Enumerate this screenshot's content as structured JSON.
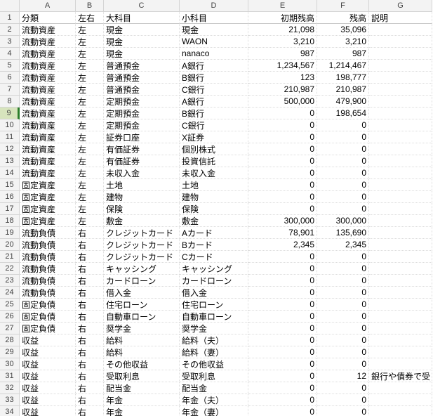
{
  "columns": [
    "A",
    "B",
    "C",
    "D",
    "E",
    "F",
    "G"
  ],
  "headers": {
    "A": "分類",
    "B": "左右",
    "C": "大科目",
    "D": "小科目",
    "E": "初期残高",
    "F": "残高",
    "G": "説明"
  },
  "selected_row": 9,
  "chart_data": {
    "type": "table",
    "columns": [
      "分類",
      "左右",
      "大科目",
      "小科目",
      "初期残高",
      "残高",
      "説明"
    ],
    "rows": [
      [
        "流動資産",
        "左",
        "現金",
        "現金",
        "21,098",
        "35,096",
        ""
      ],
      [
        "流動資産",
        "左",
        "現金",
        "WAON",
        "3,210",
        "3,210",
        ""
      ],
      [
        "流動資産",
        "左",
        "現金",
        "nanaco",
        "987",
        "987",
        ""
      ],
      [
        "流動資産",
        "左",
        "普通預金",
        "A銀行",
        "1,234,567",
        "1,214,467",
        ""
      ],
      [
        "流動資産",
        "左",
        "普通預金",
        "B銀行",
        "123",
        "198,777",
        ""
      ],
      [
        "流動資産",
        "左",
        "普通預金",
        "C銀行",
        "210,987",
        "210,987",
        ""
      ],
      [
        "流動資産",
        "左",
        "定期預金",
        "A銀行",
        "500,000",
        "479,900",
        ""
      ],
      [
        "流動資産",
        "左",
        "定期預金",
        "B銀行",
        "0",
        "198,654",
        ""
      ],
      [
        "流動資産",
        "左",
        "定期預金",
        "C銀行",
        "0",
        "0",
        ""
      ],
      [
        "流動資産",
        "左",
        "証券口座",
        "X証券",
        "0",
        "0",
        ""
      ],
      [
        "流動資産",
        "左",
        "有価証券",
        "個別株式",
        "0",
        "0",
        ""
      ],
      [
        "流動資産",
        "左",
        "有価証券",
        "投資信託",
        "0",
        "0",
        ""
      ],
      [
        "流動資産",
        "左",
        "未収入金",
        "未収入金",
        "0",
        "0",
        ""
      ],
      [
        "固定資産",
        "左",
        "土地",
        "土地",
        "0",
        "0",
        ""
      ],
      [
        "固定資産",
        "左",
        "建物",
        "建物",
        "0",
        "0",
        ""
      ],
      [
        "固定資産",
        "左",
        "保険",
        "保険",
        "0",
        "0",
        ""
      ],
      [
        "固定資産",
        "左",
        "敷金",
        "敷金",
        "300,000",
        "300,000",
        ""
      ],
      [
        "流動負債",
        "右",
        "クレジットカード",
        "Aカード",
        "78,901",
        "135,690",
        ""
      ],
      [
        "流動負債",
        "右",
        "クレジットカード",
        "Bカード",
        "2,345",
        "2,345",
        ""
      ],
      [
        "流動負債",
        "右",
        "クレジットカード",
        "Cカード",
        "0",
        "0",
        ""
      ],
      [
        "流動負債",
        "右",
        "キャッシング",
        "キャッシング",
        "0",
        "0",
        ""
      ],
      [
        "流動負債",
        "右",
        "カードローン",
        "カードローン",
        "0",
        "0",
        ""
      ],
      [
        "流動負債",
        "右",
        "借入金",
        "借入金",
        "0",
        "0",
        ""
      ],
      [
        "固定負債",
        "右",
        "住宅ローン",
        "住宅ローン",
        "0",
        "0",
        ""
      ],
      [
        "固定負債",
        "右",
        "自動車ローン",
        "自動車ローン",
        "0",
        "0",
        ""
      ],
      [
        "固定負債",
        "右",
        "奨学金",
        "奨学金",
        "0",
        "0",
        ""
      ],
      [
        "収益",
        "右",
        "給料",
        "給料（夫）",
        "0",
        "0",
        ""
      ],
      [
        "収益",
        "右",
        "給料",
        "給料（妻）",
        "0",
        "0",
        ""
      ],
      [
        "収益",
        "右",
        "その他収益",
        "その他収益",
        "0",
        "0",
        ""
      ],
      [
        "収益",
        "右",
        "受取利息",
        "受取利息",
        "0",
        "12",
        "銀行や債券で受"
      ],
      [
        "収益",
        "右",
        "配当金",
        "配当金",
        "0",
        "0",
        ""
      ],
      [
        "収益",
        "右",
        "年金",
        "年金（夫）",
        "0",
        "0",
        ""
      ],
      [
        "収益",
        "右",
        "年金",
        "年金（妻）",
        "0",
        "0",
        ""
      ]
    ]
  }
}
